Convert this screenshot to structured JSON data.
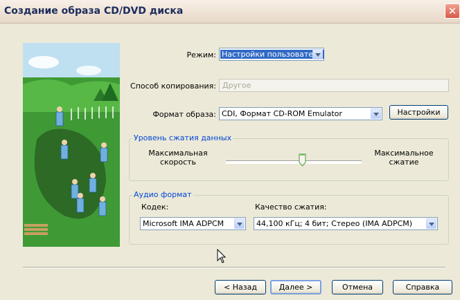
{
  "window": {
    "title": "Создание образа CD/DVD диска",
    "close_symbol": "✕"
  },
  "mode": {
    "label": "Режим:",
    "value": "Настройки пользователя"
  },
  "copy_method": {
    "label": "Способ копирования:",
    "value": "Другое"
  },
  "image_format": {
    "label": "Формат образа:",
    "value": "CDI, Формат CD-ROM Emulator",
    "settings_button": "Настройки"
  },
  "compression": {
    "group_title": "Уровень сжатия данных",
    "left_label_line1": "Максимальная",
    "left_label_line2": "скорость",
    "right_label_line1": "Максимальное",
    "right_label_line2": "сжатие",
    "slider_level_fraction": 0.56
  },
  "audio": {
    "group_title": "Аудио формат",
    "codec_label": "Кодек:",
    "codec_value": "Microsoft IMA ADPCM",
    "quality_label": "Качество сжатия:",
    "quality_value": "44,100 кГц; 4 бит; Стерео (IMA ADPCM)"
  },
  "buttons": {
    "back": "< Назад",
    "next": "Далее >",
    "cancel": "Отмена",
    "help": "Справка"
  },
  "colors": {
    "accent": "#316ac5",
    "group_title": "#0046d5",
    "title_text": "#1c2c5c"
  }
}
